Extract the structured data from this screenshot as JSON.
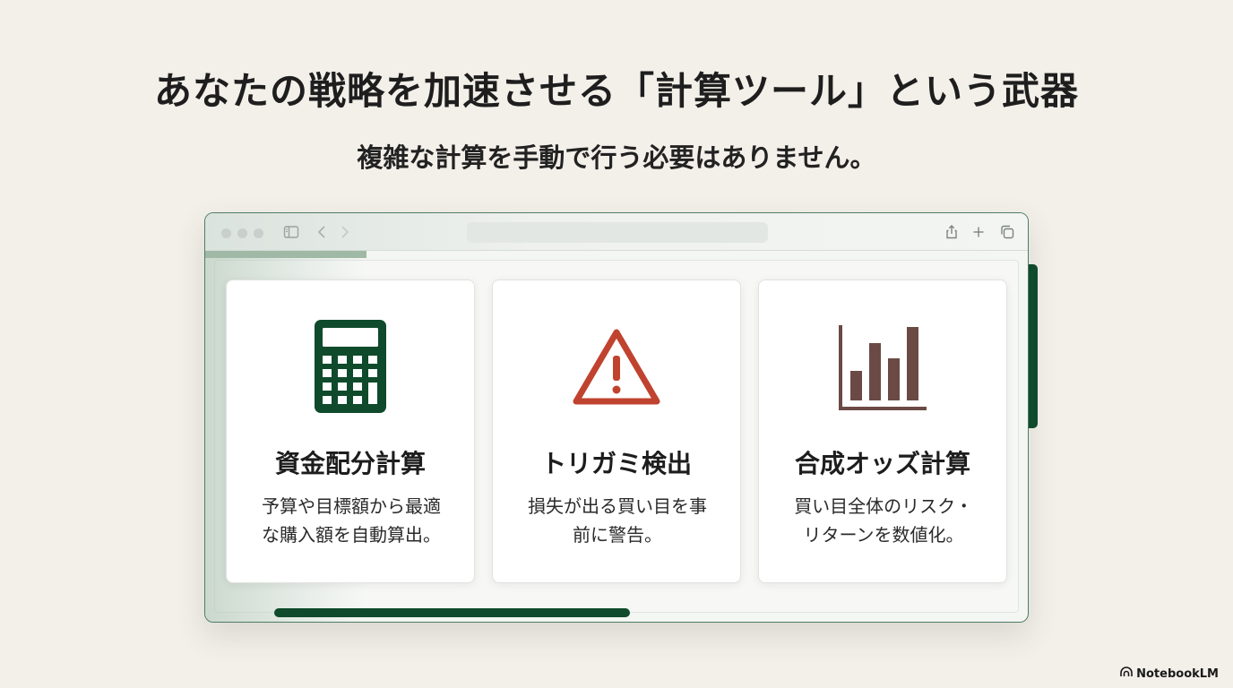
{
  "page": {
    "title": "あなたの戦略を加速させる「計算ツール」という武器",
    "subtitle": "複雑な計算を手動で行う必要はありません。"
  },
  "colors": {
    "background": "#f3efe9",
    "accent_green": "#0f4a2c",
    "warning_red": "#c0432f",
    "chart_brown": "#6b4a45"
  },
  "browser": {
    "toolbar_icons": [
      "sidebar-icon",
      "back-chevron-icon",
      "forward-chevron-icon",
      "share-icon",
      "new-tab-plus-icon",
      "tabs-overview-icon"
    ]
  },
  "cards": [
    {
      "icon": "calculator-icon",
      "title": "資金配分計算",
      "desc_line1": "予算や目標額から最適",
      "desc_line2": "な購入額を自動算出。"
    },
    {
      "icon": "warning-triangle-icon",
      "title": "トリガミ検出",
      "desc_line1": "損失が出る買い目を事",
      "desc_line2": "前に警告。"
    },
    {
      "icon": "bar-chart-icon",
      "title": "合成オッズ計算",
      "desc_line1": "買い目全体のリスク・",
      "desc_line2": "リターンを数値化。"
    }
  ],
  "brand": {
    "label": "NotebookLM"
  }
}
